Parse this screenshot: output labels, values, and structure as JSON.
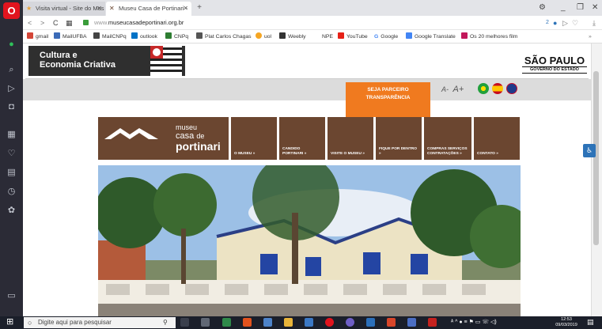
{
  "browser": {
    "tabs": [
      {
        "label": "Visita virtual - Site do Mus",
        "close": "✕"
      },
      {
        "label": "Museu Casa de Portinari -",
        "close": "✕"
      }
    ],
    "new_tab": "+",
    "window_controls": [
      "⚙",
      "_",
      "❐",
      "✕"
    ],
    "url_host": "www.",
    "url_main": "museucasadeportinari.org.br",
    "addr_right": "2"
  },
  "bookmarks": [
    {
      "label": "gmail",
      "color": "#d44638"
    },
    {
      "label": "MailUFBA",
      "color": "#3b6bb8"
    },
    {
      "label": "MailCNPq",
      "color": "#444444"
    },
    {
      "label": "outlook",
      "color": "#0072c6"
    },
    {
      "label": "CNPq",
      "color": "#2e7d32"
    },
    {
      "label": "Plat Carlos Chagas",
      "color": "#555555"
    },
    {
      "label": "uol",
      "color": "#f5a623"
    },
    {
      "label": "Weebly",
      "color": "#333333"
    },
    {
      "label": "NPE",
      "color": "#ffffff"
    },
    {
      "label": "YouTube",
      "color": "#e62117"
    },
    {
      "label": "Google",
      "color": "#4285f4"
    },
    {
      "label": "Google Translate",
      "color": "#4285f4"
    },
    {
      "label": "Os 20 melhores film",
      "color": "#c2185b"
    }
  ],
  "site": {
    "banner_title_1": "Cultura e",
    "banner_title_2": "Economia Criativa",
    "sp_logo": "SÃO PAULO",
    "sp_sub": "GOVERNO DO ESTADO",
    "partner_1": "SEJA PARCEIRO",
    "partner_2": "TRANSPARÊNCIA",
    "font_small": "A-",
    "font_large": "A+",
    "logo_1": "museu",
    "logo_2": "casa",
    "logo_2b": "de",
    "logo_3": "portinari",
    "menu": [
      "O MUSEU »",
      "CANDIDO PORTINARI »",
      "VISITE O MUSEU »",
      "FIQUE POR DENTRO »",
      "COMPRAS SERVIÇOS CONTRATAÇÕES »",
      "CONTATO »"
    ]
  },
  "taskbar": {
    "search_placeholder": "Digite aqui para pesquisar",
    "time": "12:53",
    "date": "09/03/2019"
  }
}
